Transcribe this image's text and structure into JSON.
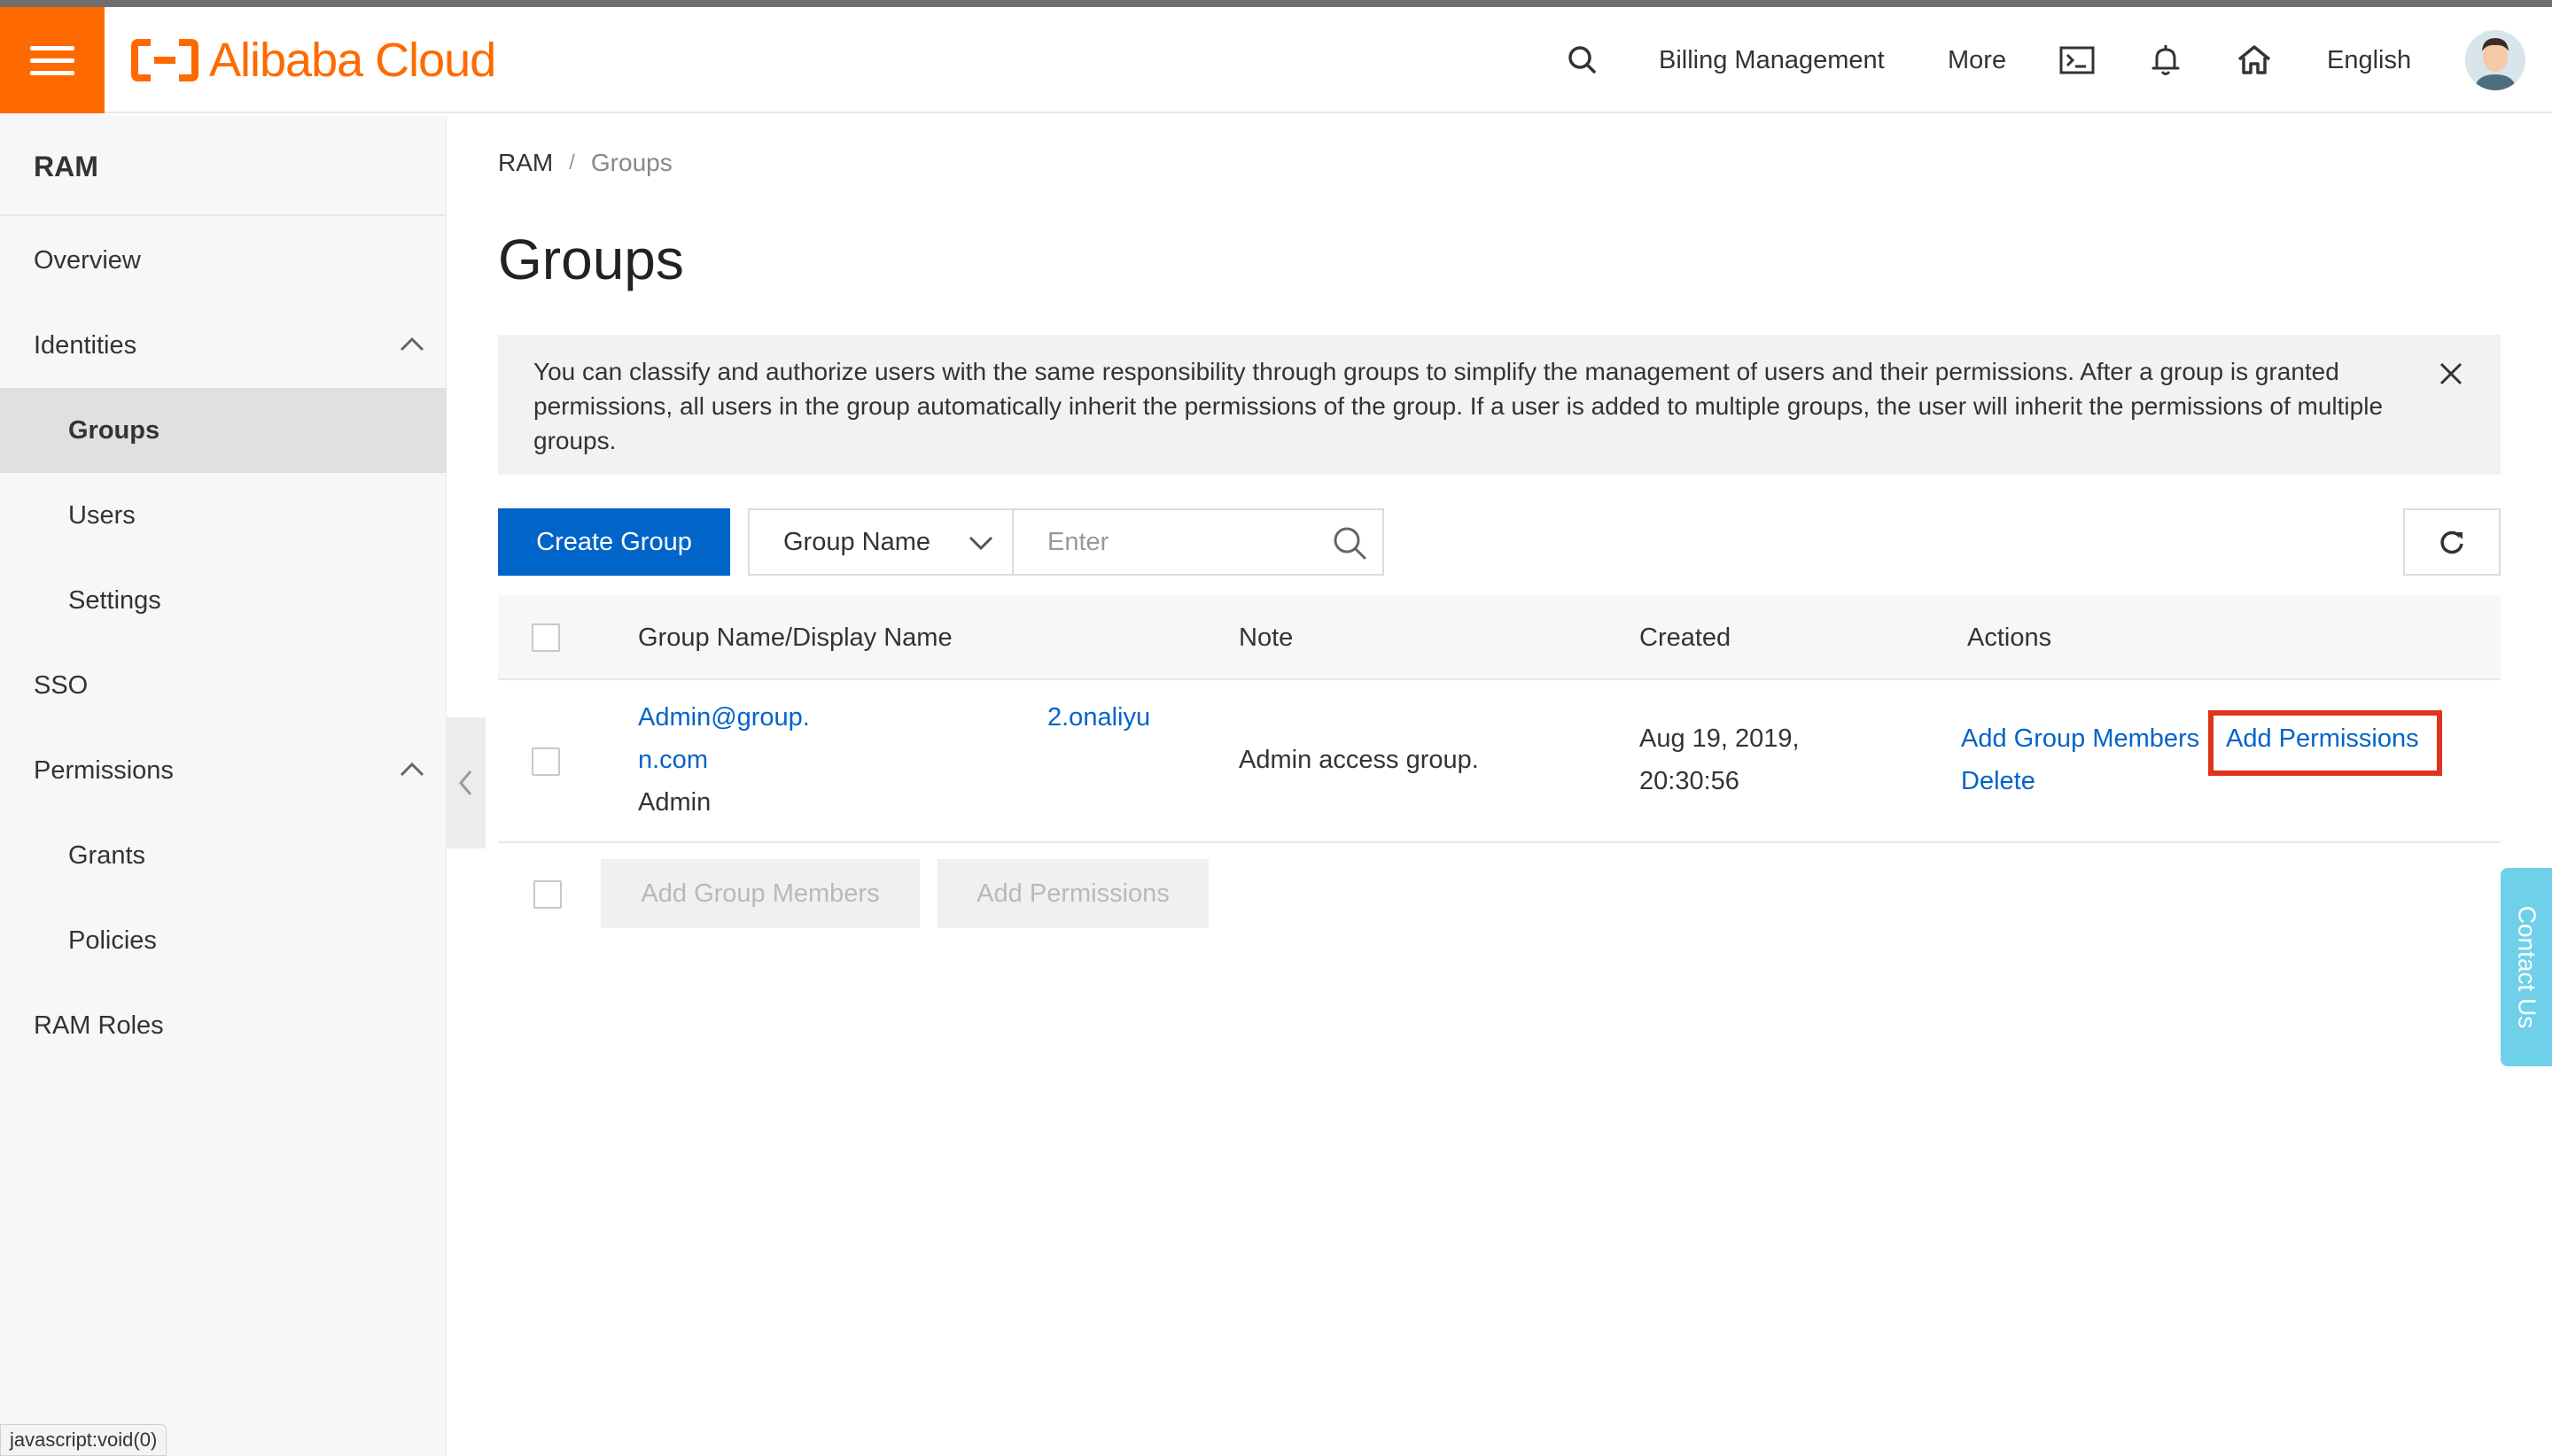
{
  "header": {
    "logo_text": "Alibaba Cloud",
    "billing": "Billing Management",
    "more": "More",
    "language": "English",
    "brand_color": "#ff6a00"
  },
  "sidebar": {
    "title": "RAM",
    "items": [
      {
        "label": "Overview"
      },
      {
        "label": "Identities"
      },
      {
        "label": "Groups"
      },
      {
        "label": "Users"
      },
      {
        "label": "Settings"
      },
      {
        "label": "SSO"
      },
      {
        "label": "Permissions"
      },
      {
        "label": "Grants"
      },
      {
        "label": "Policies"
      },
      {
        "label": "RAM Roles"
      }
    ]
  },
  "breadcrumb": {
    "root": "RAM",
    "separator": "/",
    "current": "Groups"
  },
  "page": {
    "title": "Groups"
  },
  "notice": {
    "text": "You can classify and authorize users with the same responsibility through groups to simplify the management of users and their permissions. After a group is granted permissions, all users in the group automatically inherit the permissions of the group. If a user is added to multiple groups, the user will inherit the permissions of multiple groups."
  },
  "toolbar": {
    "create_label": "Create Group",
    "filter_selected": "Group Name",
    "search_placeholder": "Enter",
    "accent_color": "#0064c8"
  },
  "table": {
    "columns": [
      "Group Name/Display Name",
      "Note",
      "Created",
      "Actions"
    ],
    "rows": [
      {
        "name_line1": "Admin@group.",
        "name_line1_right": "2.onaliyu",
        "name_line2": "n.com",
        "display_name": "Admin",
        "note": "Admin access group.",
        "created_line1": "Aug 19, 2019,",
        "created_line2": "20:30:56",
        "action_add_members": "Add Group Members",
        "action_add_permissions": "Add Permissions",
        "action_delete": "Delete"
      }
    ]
  },
  "bulk": {
    "add_members": "Add Group Members",
    "add_permissions": "Add Permissions"
  },
  "contact": {
    "label": "Contact Us"
  },
  "status_bar": {
    "text": "javascript:void(0)"
  }
}
